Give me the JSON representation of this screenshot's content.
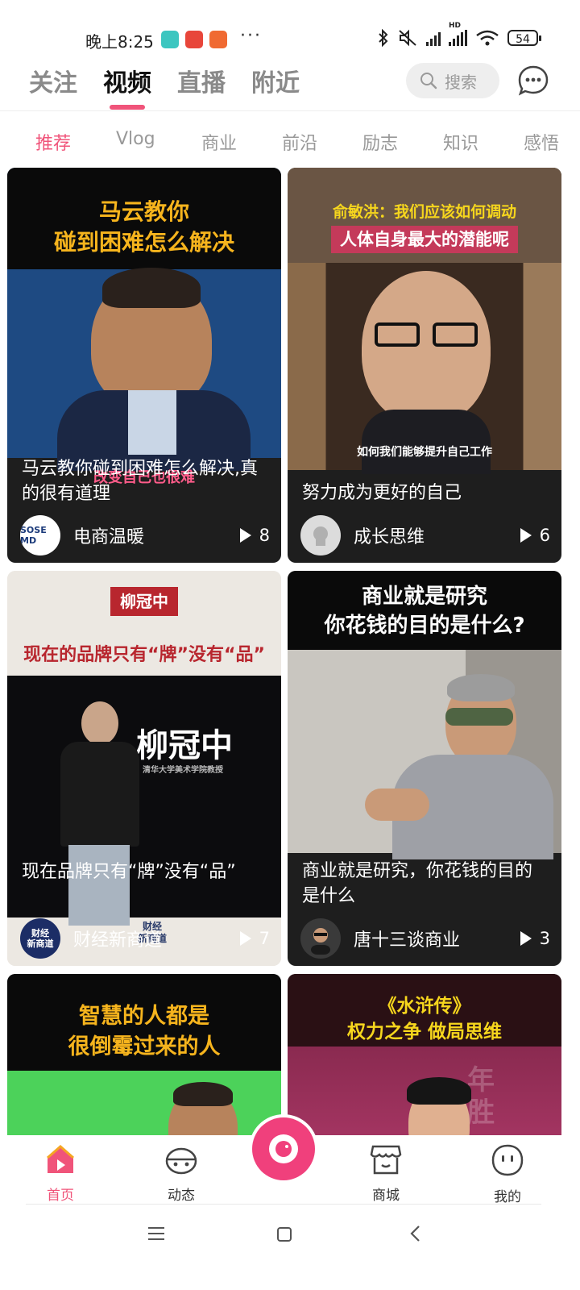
{
  "status_bar": {
    "time": "晚上8:25",
    "dots": "···",
    "network_label": "HD",
    "battery": "54",
    "colors": {
      "app1": "#3cc6c0",
      "app2": "#e8463a",
      "app3": "#f06a32"
    }
  },
  "top_tabs": [
    {
      "label": "关注",
      "active": false
    },
    {
      "label": "视频",
      "active": true
    },
    {
      "label": "直播",
      "active": false
    },
    {
      "label": "附近",
      "active": false
    }
  ],
  "search": {
    "label": "搜索",
    "icon": "search-icon"
  },
  "message_icon": "chat-bubble-icon",
  "categories": [
    {
      "label": "推荐",
      "active": true
    },
    {
      "label": "Vlog",
      "active": false
    },
    {
      "label": "商业",
      "active": false
    },
    {
      "label": "前沿",
      "active": false
    },
    {
      "label": "励志",
      "active": false
    },
    {
      "label": "知识",
      "active": false
    },
    {
      "label": "感悟",
      "active": false
    }
  ],
  "cards": [
    {
      "banner": "马云教你\n碰到困难怎么解决",
      "subtitle_overlay": "改变自己也很难",
      "title": "马云教你碰到困难怎么解决,真的很有道理",
      "author": "电商温暖",
      "avatar_text": "SOSE MD",
      "plays": "8"
    },
    {
      "banner": "俞敏洪：我们应该如何调动",
      "banner2": "人体自身最大的潜能呢",
      "subtitle_overlay": "如何我们能够提升自己工作",
      "title": "努力成为更好的自己",
      "author": "成长思维",
      "plays": "6"
    },
    {
      "stamp": "柳冠中",
      "banner": "现在的品牌只有“牌”没有“品”",
      "stage_text": "柳冠中",
      "stage_small": "清华大学美术学院教授",
      "title": "现在品牌只有“牌”没有“品”",
      "author": "财经新商道",
      "avatar_text": "财经\n新商道",
      "watermark": "财经\n新商道",
      "plays": "7"
    },
    {
      "banner": "商业就是研究\n你花钱的目的是什么?",
      "title": "商业就是研究，你花钱的目的是什么",
      "author": "唐十三谈商业",
      "plays": "3"
    },
    {
      "banner": "智慧的人都是\n很倒霉过来的人"
    },
    {
      "banner": "《水浒传》\n权力之争 做局思维",
      "bg_chars": "年\n胜"
    }
  ],
  "bottom_nav": [
    {
      "label": "首页",
      "icon": "home-play-icon",
      "active": true
    },
    {
      "label": "动态",
      "icon": "moments-face-icon",
      "active": false
    },
    {
      "label": "",
      "icon": "camera-icon",
      "active": false
    },
    {
      "label": "商城",
      "icon": "shop-icon",
      "active": false
    },
    {
      "label": "我的",
      "icon": "profile-face-icon",
      "active": false
    }
  ],
  "system_nav": [
    {
      "icon": "menu-icon"
    },
    {
      "icon": "home-square-icon"
    },
    {
      "icon": "back-icon"
    }
  ],
  "accent_color": "#f0547a"
}
